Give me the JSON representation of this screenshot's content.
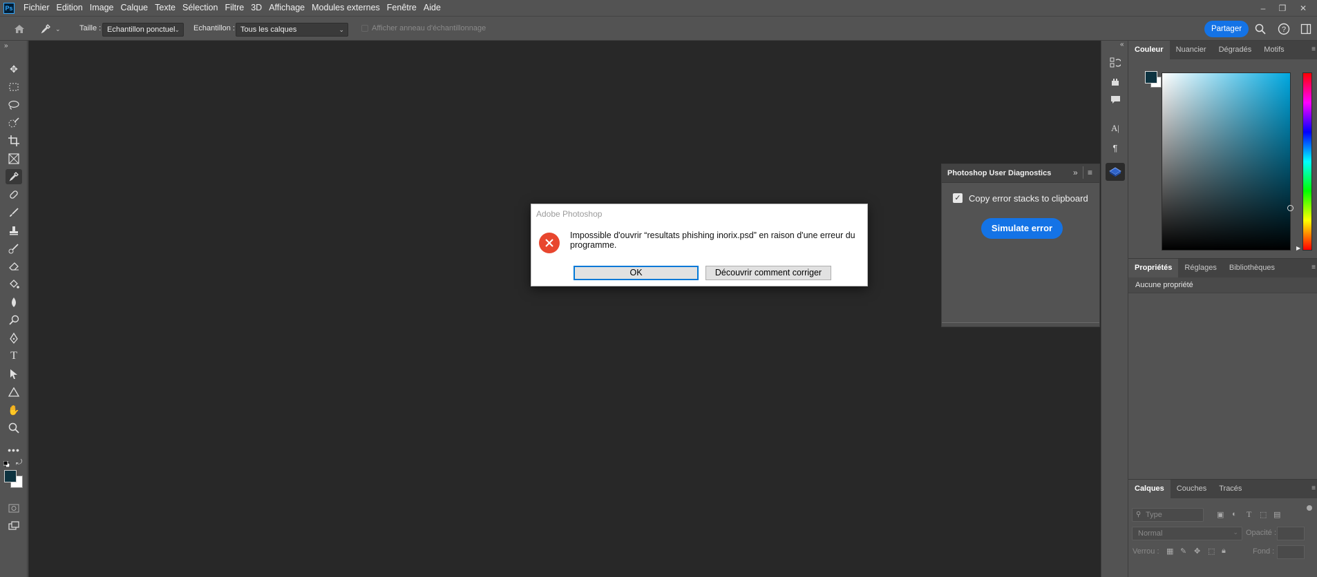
{
  "menubar": {
    "logo_text": "Ps",
    "items": [
      "Fichier",
      "Edition",
      "Image",
      "Calque",
      "Texte",
      "Sélection",
      "Filtre",
      "3D",
      "Affichage",
      "Modules externes",
      "Fenêtre",
      "Aide"
    ],
    "win_controls": [
      "–",
      "❐",
      "✕"
    ]
  },
  "options": {
    "size_label": "Taille :",
    "size_value": "Echantillon ponctuel",
    "sample_label": "Echantillon :",
    "sample_value": "Tous les calques",
    "ring_label": "Afficher anneau d'échantillonnage",
    "share_label": "Partager"
  },
  "colors": {
    "foreground": "#0d3340",
    "background": "#ffffff",
    "accent": "#1473e6"
  },
  "color_panel": {
    "tabs": [
      "Couleur",
      "Nuancier",
      "Dégradés",
      "Motifs"
    ]
  },
  "properties_panel": {
    "tabs": [
      "Propriétés",
      "Réglages",
      "Bibliothèques"
    ],
    "empty_text": "Aucune propriété"
  },
  "layers_panel": {
    "tabs": [
      "Calques",
      "Couches",
      "Tracés"
    ],
    "filter_placeholder": "Type",
    "blend_mode": "Normal",
    "opacity_label": "Opacité :",
    "lock_label": "Verrou :",
    "fill_label": "Fond :"
  },
  "diagnostics": {
    "title": "Photoshop User Diagnostics",
    "checkbox_label": "Copy error stacks to clipboard",
    "checkbox_checked": true,
    "button_label": "Simulate error"
  },
  "dialog": {
    "title": "Adobe Photoshop",
    "message": "Impossible d'ouvrir “resultats phishing inorix.psd” en raison d'une erreur du programme.",
    "ok_label": "OK",
    "fix_label": "Découvrir comment corriger"
  }
}
